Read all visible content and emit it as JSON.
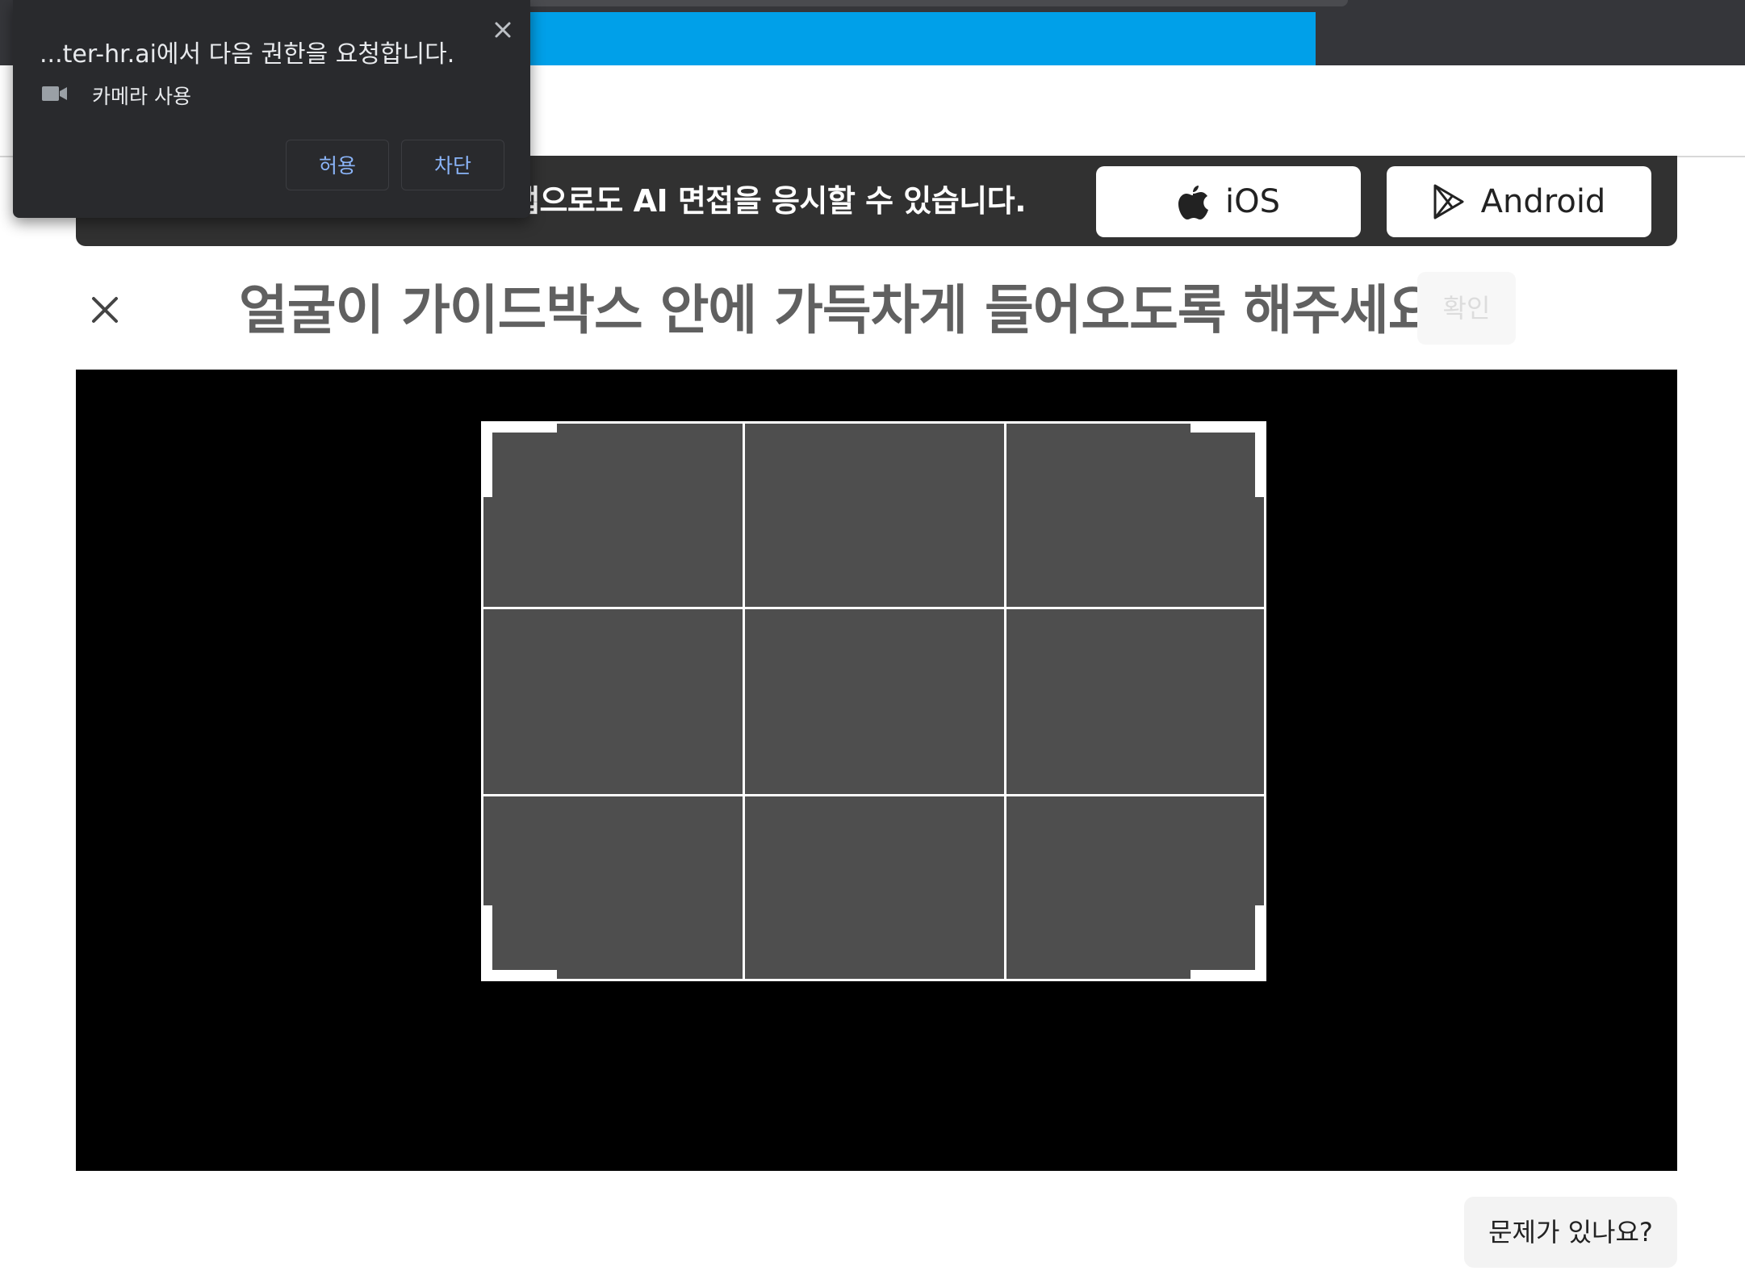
{
  "browser": {
    "permission_popup": {
      "title": "...ter-hr.ai에서 다음 권한을 요청합니다.",
      "permission_label": "카메라 사용",
      "permission_icon": "camera-icon",
      "allow_label": "허용",
      "block_label": "차단",
      "accent_color": "#8ab4f8"
    },
    "progress_color": "#00a0e9"
  },
  "banner": {
    "text": "앱으로도 AI 면접을 응시할 수 있습니다.",
    "ios_label": "iOS",
    "ios_icon": "apple-icon",
    "android_label": "Android",
    "android_icon": "play-store-icon"
  },
  "main": {
    "title": "얼굴이 가이드박스 안에 가득차게 들어오도록 해주세요",
    "confirm_label": "확인",
    "close_icon": "close-icon",
    "help_label": "문제가 있나요?"
  }
}
